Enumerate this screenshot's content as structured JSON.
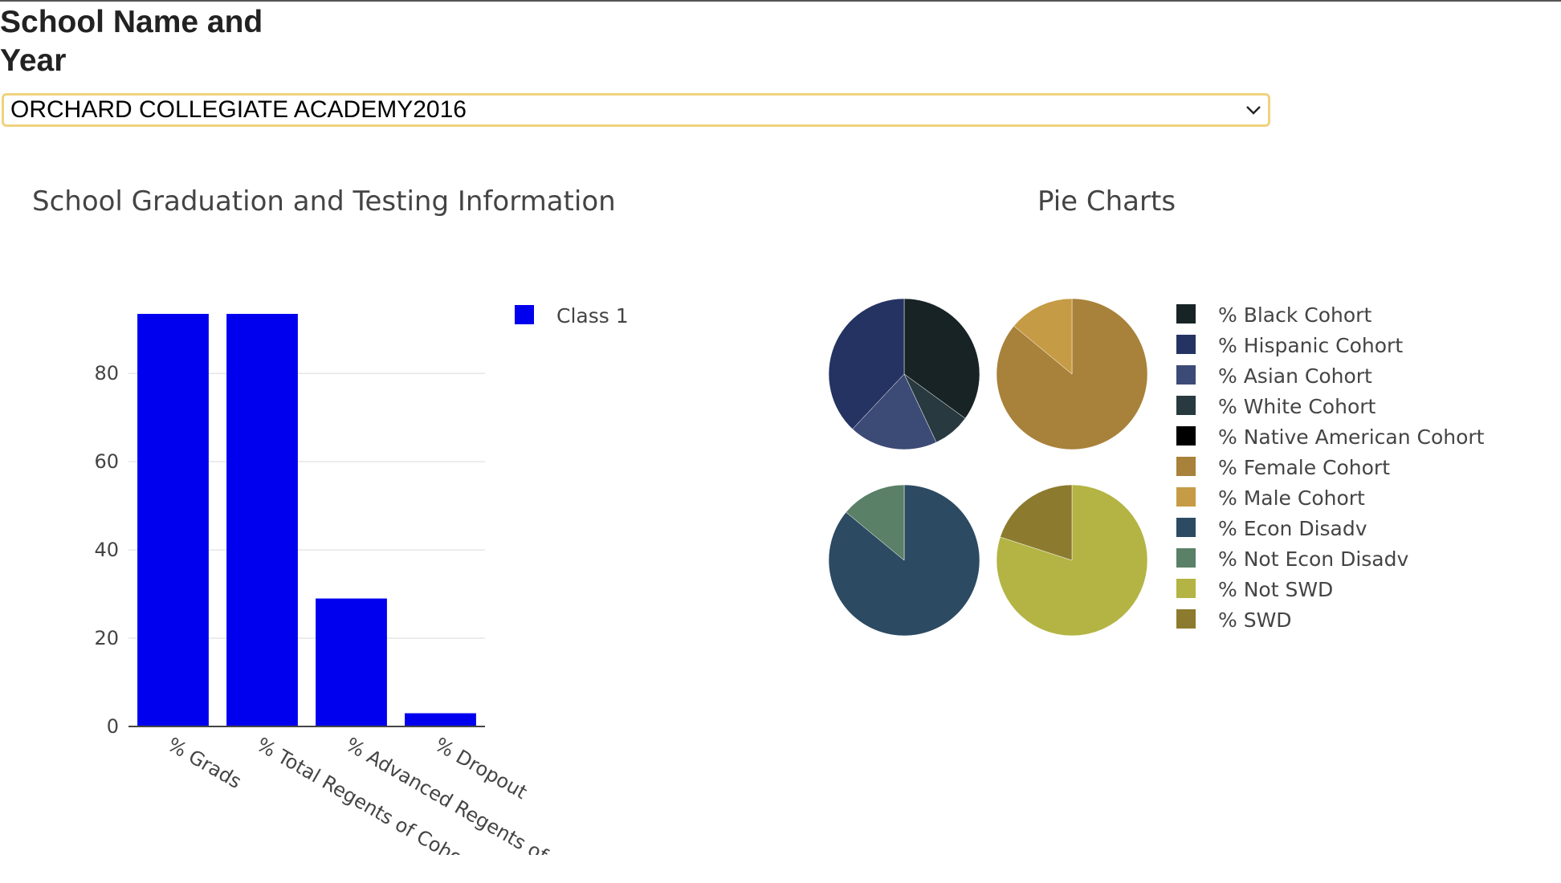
{
  "header": {
    "title": "School Name and Year"
  },
  "school_select": {
    "value": "ORCHARD COLLEGIATE ACADEMY2016"
  },
  "icons": {
    "select_arrow": "chevron-down-icon"
  },
  "colors": {
    "select_border": "#f0d27e",
    "bar": "#0000ee"
  },
  "chart_data": [
    {
      "type": "bar",
      "title": "School Graduation and Testing Information",
      "categories": [
        "% Grads",
        "% Total Regents of Cohort",
        "% Advanced Regents of Cohort",
        "% Dropout"
      ],
      "series": [
        {
          "name": "Class 1",
          "values": [
            93.5,
            93.5,
            29,
            3
          ],
          "color": "#0000ee"
        }
      ],
      "ylim": [
        0,
        93.5
      ],
      "yticks": [
        0,
        20,
        40,
        60,
        80
      ],
      "grid": true,
      "legend": "top-right"
    },
    {
      "type": "pie",
      "title": "Pie Charts",
      "legend": "right",
      "pies": [
        {
          "slices": [
            {
              "label": "% Black Cohort",
              "value": 35,
              "color": "#182325"
            },
            {
              "label": "% White Cohort",
              "value": 8,
              "color": "#283a3f"
            },
            {
              "label": "% Asian Cohort",
              "value": 19,
              "color": "#3c4a76"
            },
            {
              "label": "% Hispanic Cohort",
              "value": 38,
              "color": "#253362"
            },
            {
              "label": "% Native American Cohort",
              "value": 0,
              "color": "#000000"
            }
          ]
        },
        {
          "slices": [
            {
              "label": "% Female Cohort",
              "value": 86,
              "color": "#a8813a"
            },
            {
              "label": "% Male Cohort",
              "value": 14,
              "color": "#c69b45"
            }
          ]
        },
        {
          "slices": [
            {
              "label": "% Econ Disadv",
              "value": 86,
              "color": "#2c4a62"
            },
            {
              "label": "% Not Econ Disadv",
              "value": 14,
              "color": "#5a8068"
            }
          ]
        },
        {
          "slices": [
            {
              "label": "% Not SWD",
              "value": 80,
              "color": "#b3b443"
            },
            {
              "label": "% SWD",
              "value": 20,
              "color": "#8c7b2e"
            }
          ]
        }
      ],
      "legend_items": [
        {
          "label": "% Black Cohort",
          "color": "#182325"
        },
        {
          "label": "% Hispanic Cohort",
          "color": "#253362"
        },
        {
          "label": "% Asian Cohort",
          "color": "#3c4a76"
        },
        {
          "label": "% White Cohort",
          "color": "#283a3f"
        },
        {
          "label": "% Native American Cohort",
          "color": "#000000"
        },
        {
          "label": "% Female Cohort",
          "color": "#a8813a"
        },
        {
          "label": "% Male Cohort",
          "color": "#c69b45"
        },
        {
          "label": "% Econ Disadv",
          "color": "#2c4a62"
        },
        {
          "label": "% Not Econ Disadv",
          "color": "#5a8068"
        },
        {
          "label": "% Not SWD",
          "color": "#b3b443"
        },
        {
          "label": "% SWD",
          "color": "#8c7b2e"
        }
      ]
    }
  ]
}
